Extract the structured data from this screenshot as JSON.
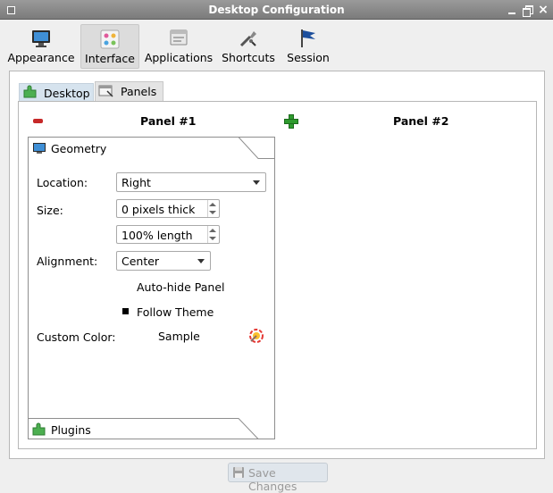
{
  "window": {
    "title": "Desktop Configuration",
    "close_glyph": "×"
  },
  "toolbar": {
    "items": [
      {
        "label": "Appearance",
        "icon": "monitor-icon"
      },
      {
        "label": "Interface",
        "icon": "interface-icon",
        "active": true
      },
      {
        "label": "Applications",
        "icon": "applications-icon"
      },
      {
        "label": "Shortcuts",
        "icon": "shortcuts-icon"
      },
      {
        "label": "Session",
        "icon": "flag-icon"
      }
    ]
  },
  "subtabs": {
    "desktop": "Desktop",
    "panels": "Panels"
  },
  "panels": {
    "panel1_title": "Panel #1",
    "panel2_title": "Panel #2"
  },
  "geometry": {
    "section_title": "Geometry",
    "location_label": "Location:",
    "location_value": "Right",
    "size_label": "Size:",
    "size_thickness": "0 pixels thick",
    "size_length": "100% length",
    "alignment_label": "Alignment:",
    "alignment_value": "Center",
    "autohide_label": "Auto-hide Panel",
    "follow_theme_label": "Follow Theme",
    "custom_color_label": "Custom Color:",
    "custom_color_value": "Sample"
  },
  "plugins": {
    "section_title": "Plugins"
  },
  "footer": {
    "save_label": "Save Changes"
  },
  "colors": {
    "titlebar": "#8a8a8a",
    "active_tab": "#d6e3ee",
    "remove": "#c62828",
    "add": "#2e9a2e"
  }
}
